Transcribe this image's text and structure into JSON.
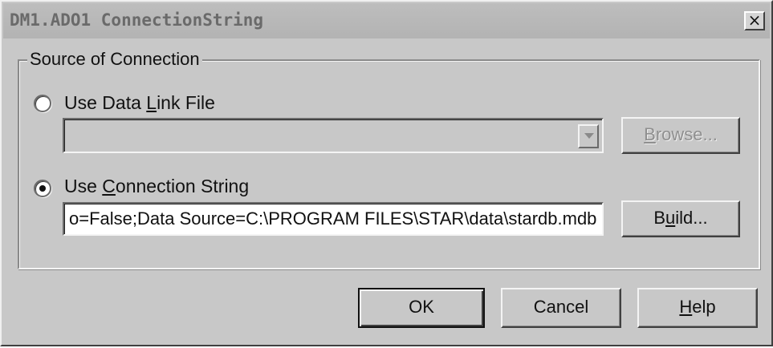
{
  "window": {
    "title": "DM1.ADO1 ConnectionString",
    "close_symbol": "×"
  },
  "group": {
    "legend": "Source of Connection"
  },
  "options": {
    "data_link": {
      "label_pre": "Use Data ",
      "label_mnemonic": "L",
      "label_post": "ink File",
      "selected": false,
      "combo_value": "",
      "browse_pre": "",
      "browse_mnemonic": "B",
      "browse_post": "rowse..."
    },
    "connection_string": {
      "label_pre": "Use ",
      "label_mnemonic": "C",
      "label_post": "onnection String",
      "selected": true,
      "value": "o=False;Data Source=C:\\PROGRAM FILES\\STAR\\data\\stardb.mdb",
      "build_pre": "B",
      "build_mnemonic": "u",
      "build_post": "ild..."
    }
  },
  "buttons": {
    "ok": "OK",
    "cancel": "Cancel",
    "help_mnemonic": "H",
    "help_post": "elp"
  },
  "icons": {
    "close": "close-icon",
    "dropdown": "chevron-down-icon",
    "radio": "radio-icon"
  },
  "colors": {
    "dialog_face": "#c8c8c8",
    "title_text": "#6a6a6a",
    "disabled_text": "#8f8f8f"
  }
}
